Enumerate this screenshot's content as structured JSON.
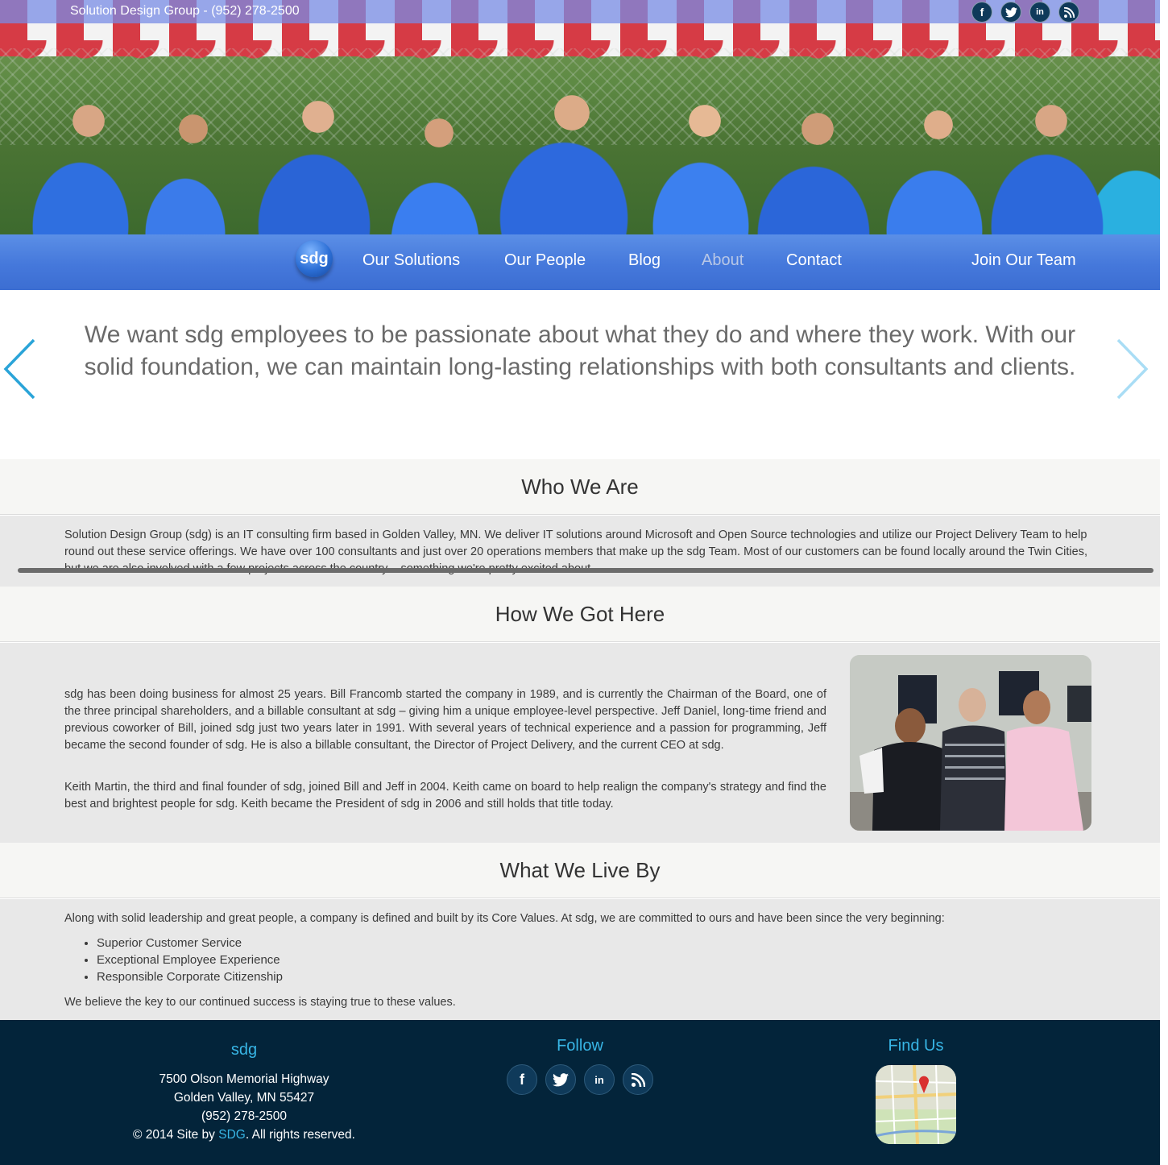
{
  "topbar": {
    "text": "Solution Design Group - (952) 278-2500",
    "social_icons": [
      "facebook-icon",
      "twitter-icon",
      "linkedin-icon",
      "rss-icon"
    ]
  },
  "nav": {
    "logo": "sdg",
    "items": [
      "Our Solutions",
      "Our People",
      "Blog",
      "About",
      "Contact"
    ],
    "active": "About",
    "join": "Join Our Team"
  },
  "quote": {
    "text": "We want sdg employees to be passionate about what they do and where they work. With our solid foundation, we can maintain long-lasting relationships with both consultants and clients."
  },
  "sections": {
    "who": {
      "title": "Who We Are",
      "body": "Solution Design Group (sdg) is an IT consulting firm based in Golden Valley, MN. We deliver IT solutions around Microsoft and Open Source technologies and utilize our Project Delivery Team to help round out these service offerings. We have over 100 consultants and just over 20 operations members that make up the sdg Team. Most of our customers can be found locally around the Twin Cities, but we are also involved with a few projects across the country – something we're pretty excited about."
    },
    "how": {
      "title": "How We Got Here",
      "p1": "sdg has been doing business for almost 25 years. Bill Francomb started the company in 1989, and is currently the Chairman of the Board, one of the three principal shareholders, and a billable consultant at sdg – giving him a unique employee-level perspective. Jeff Daniel, long-time friend and previous coworker of Bill, joined sdg just two years later in 1991. With several years of technical experience and a passion for programming, Jeff became the second founder of sdg. He is also a billable consultant, the Director of Project Delivery, and the current CEO at sdg.",
      "p2": "Keith Martin, the third and final founder of sdg, joined Bill and Jeff in 2004. Keith came on board to help realign the company's strategy and find the best and brightest people for sdg. Keith became the President of sdg in 2006 and still holds that title today."
    },
    "live": {
      "title": "What We Live By",
      "intro": "Along with solid leadership and great people, a company is defined and built by its Core Values. At sdg, we are committed to ours and have been since the very beginning:",
      "values": [
        "Superior Customer Service",
        "Exceptional Employee Experience",
        "Responsible Corporate Citizenship"
      ],
      "outro": "We believe the key to our continued success is staying true to these values."
    }
  },
  "footer": {
    "col1_title": "sdg",
    "address1": "7500 Olson Memorial Highway",
    "address2": "Golden Valley, MN 55427",
    "phone": "(952) 278-2500",
    "copyright_pre": "© 2014 Site by ",
    "copyright_link": "SDG",
    "copyright_post": ". All rights reserved.",
    "col2_title": "Follow",
    "col3_title": "Find Us"
  },
  "colors": {
    "nav_blue": "#4578db",
    "accent": "#38b6e6",
    "footer_bg": "#03243a",
    "arrow_left": "#2aa4d8",
    "arrow_right": "#a9ddf5"
  }
}
